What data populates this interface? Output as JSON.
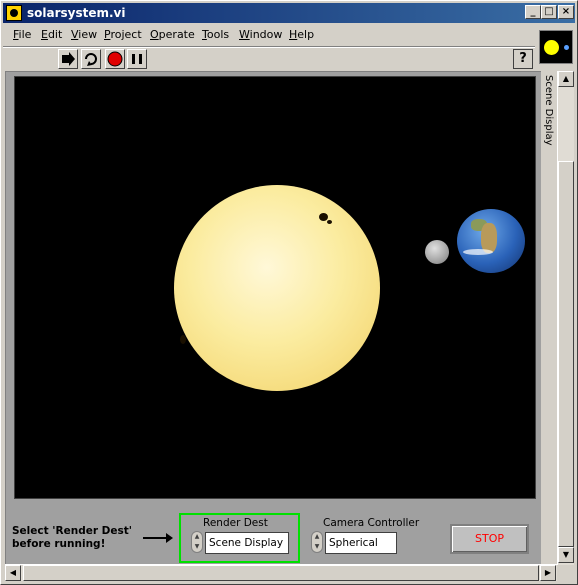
{
  "window": {
    "title": "solarsystem.vi",
    "buttons": {
      "minimize": "_",
      "maximize": "□",
      "close": "×"
    }
  },
  "menubar": {
    "items": [
      "File",
      "Edit",
      "View",
      "Project",
      "Operate",
      "Tools",
      "Window",
      "Help"
    ]
  },
  "toolbar": {
    "icons": [
      "run-arrow-icon",
      "run-continuously-icon",
      "abort-icon",
      "pause-icon"
    ],
    "help_label": "?"
  },
  "scene": {
    "label": "Scene Display",
    "background": "#000000"
  },
  "controls": {
    "note": "Select 'Render Dest' before running!",
    "render_dest": {
      "label": "Render Dest",
      "value": "Scene Display"
    },
    "camera_controller": {
      "label": "Camera Controller",
      "value": "Spherical"
    },
    "stop_label": "STOP"
  },
  "colors": {
    "title_bar": "#0a246a",
    "highlight": "#00e000",
    "stop_text": "#ff0000",
    "sun": "#fbeca0"
  }
}
